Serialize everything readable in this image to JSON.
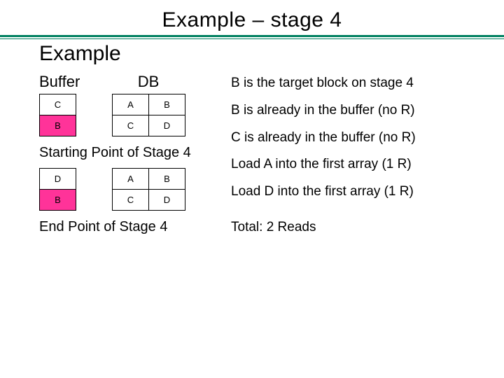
{
  "title": "Example – stage 4",
  "subtitle": "Example",
  "headers": {
    "buffer": "Buffer",
    "db": "DB"
  },
  "starting": {
    "rows": [
      {
        "buf": "C",
        "db1": "A",
        "db2": "B",
        "buf_pink": false
      },
      {
        "buf": "B",
        "db1": "C",
        "db2": "D",
        "buf_pink": true
      }
    ],
    "caption": "Starting Point of Stage 4"
  },
  "ending": {
    "rows": [
      {
        "buf": "D",
        "db1": "A",
        "db2": "B",
        "buf_pink": false
      },
      {
        "buf": "B",
        "db1": "C",
        "db2": "D",
        "buf_pink": true
      }
    ],
    "caption": "End Point of Stage 4"
  },
  "bullets": [
    "B is the target block on stage 4",
    "B is already in the buffer (no R)",
    "C is already in the buffer (no R)",
    "Load A into the first array (1 R)",
    "Load D into the first array (1 R)"
  ],
  "total": "Total: 2 Reads"
}
